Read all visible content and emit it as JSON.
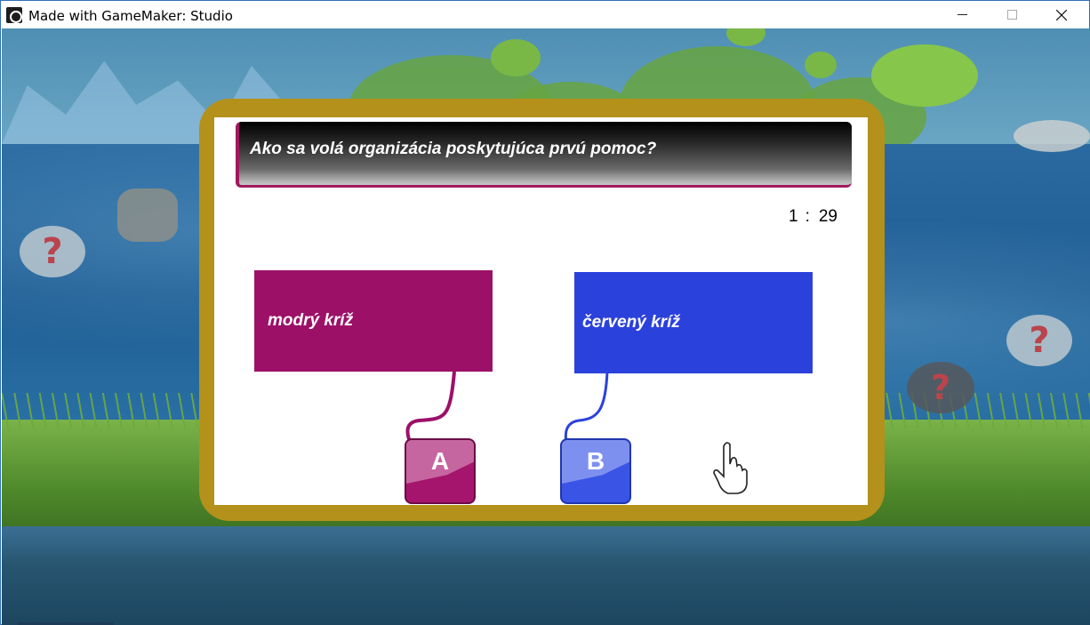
{
  "window": {
    "title": "Made with GameMaker: Studio"
  },
  "quiz": {
    "question": "Ako sa volá organizácia poskytujúca prvú pomoc?",
    "timer": {
      "minutes": "1",
      "separator": ":",
      "seconds": "29"
    },
    "answers": [
      {
        "key": "A",
        "text": "modrý kríž",
        "color": "#9c1068"
      },
      {
        "key": "B",
        "text": "červený kríž",
        "color": "#2b41dc"
      }
    ]
  },
  "decor": {
    "stone_marks": [
      "?",
      "?",
      "?"
    ],
    "frame_color": "#b3911a"
  }
}
